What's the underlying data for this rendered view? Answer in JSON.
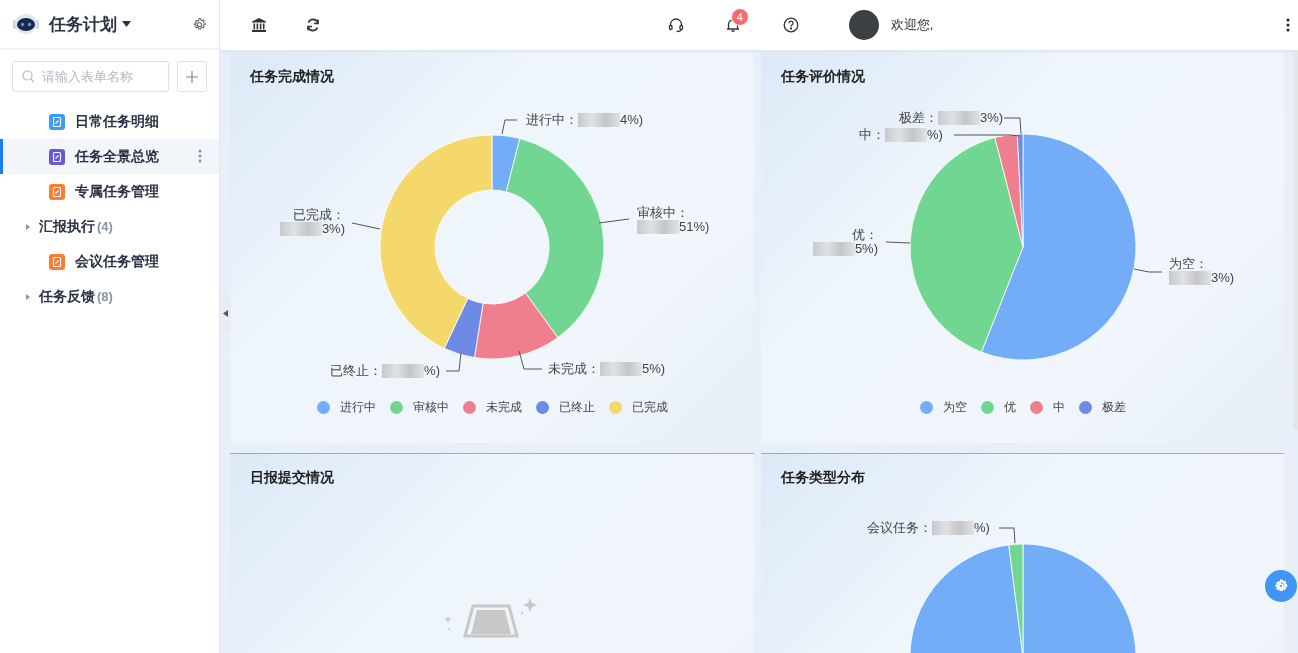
{
  "sidebar": {
    "title": "任务计划",
    "search": {
      "placeholder": "请输入表单名称"
    },
    "items": [
      {
        "kind": "form",
        "label": "日常任务明细",
        "color": "#3e9cf8",
        "selected": false
      },
      {
        "kind": "form",
        "label": "任务全景总览",
        "color": "#6758d9",
        "selected": true
      },
      {
        "kind": "form",
        "label": "专属任务管理",
        "color": "#fa7d36",
        "selected": false
      },
      {
        "kind": "group",
        "label": "汇报执行",
        "count": "(4)",
        "expanded": false,
        "selected": false
      },
      {
        "kind": "form",
        "label": "会议任务管理",
        "color": "#fa7d36",
        "selected": false
      },
      {
        "kind": "group",
        "label": "任务反馈",
        "count": "(8)",
        "expanded": false,
        "selected": false
      }
    ]
  },
  "header": {
    "notification_badge": "4",
    "greeting": "欢迎您,"
  },
  "cards": [
    {
      "title": "任务完成情况",
      "kind": "donut",
      "labels": [
        {
          "text": "进行中：",
          "suffix": "4%)"
        },
        {
          "text": "已完成：",
          "suffix": "3%)"
        },
        {
          "text": "审核中：",
          "suffix": "51%)"
        },
        {
          "text": "已终止：",
          "suffix": "%)"
        },
        {
          "text": "未完成：",
          "suffix": "5%)"
        }
      ],
      "legend": [
        {
          "label": "进行中",
          "color": "#73acf7"
        },
        {
          "label": "审核中",
          "color": "#72d693"
        },
        {
          "label": "未完成",
          "color": "#ef7f8f"
        },
        {
          "label": "已终止",
          "color": "#6d8ae6"
        },
        {
          "label": "已完成",
          "color": "#f5d86b"
        }
      ]
    },
    {
      "title": "任务评价情况",
      "kind": "pie",
      "labels": [
        {
          "text": "极差：",
          "suffix": "3%)"
        },
        {
          "text": "中：",
          "suffix": "%)"
        },
        {
          "text": "优：",
          "suffix": "5%)"
        },
        {
          "text": "为空：",
          "suffix": "3%)"
        }
      ],
      "legend": [
        {
          "label": "为空",
          "color": "#73acf7"
        },
        {
          "label": "优",
          "color": "#72d693"
        },
        {
          "label": "中",
          "color": "#ef7f8f"
        },
        {
          "label": "极差",
          "color": "#6d8ae6"
        }
      ]
    },
    {
      "title": "日报提交情况",
      "kind": "empty"
    },
    {
      "title": "任务类型分布",
      "kind": "pie",
      "labels": [
        {
          "text": "会议任务：",
          "suffix": "%)"
        }
      ]
    }
  ]
}
